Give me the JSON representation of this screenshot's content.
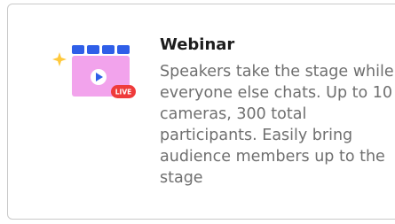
{
  "card": {
    "title": "Webinar",
    "description": "Speakers take the stage while everyone else chats. Up to 10 cameras, 300 total participants. Easily bring audience members up to the stage",
    "icon": "webinar-live-screen-icon",
    "badge_label": "LIVE"
  },
  "colors": {
    "accent_blue": "#2f5fe8",
    "screen_pink": "#f2a3ec",
    "sparkle_yellow": "#ffc93c",
    "live_red": "#ef3b3b"
  }
}
